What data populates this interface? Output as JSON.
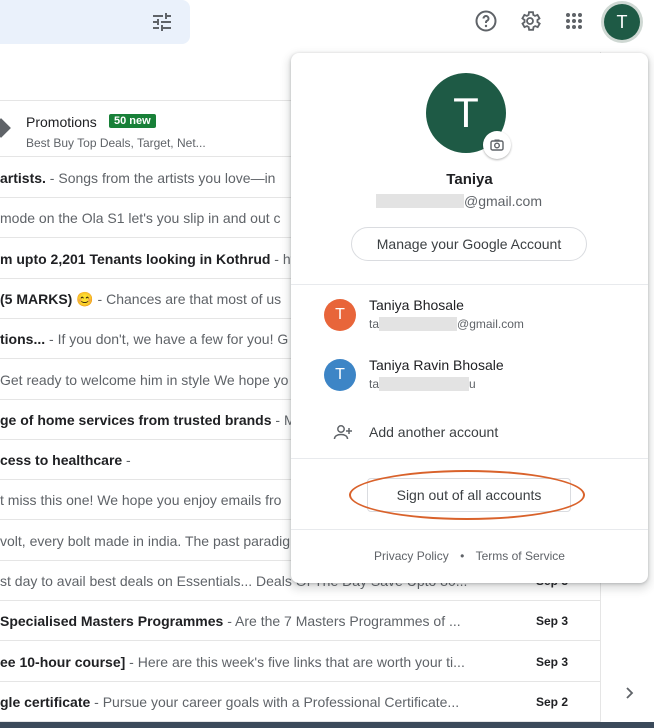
{
  "header": {
    "filter_icon": "tune-icon",
    "help_icon": "help-icon",
    "settings_icon": "gear-icon",
    "apps_icon": "apps-grid-icon",
    "avatar_letter": "T"
  },
  "promotions": {
    "title": "Promotions",
    "badge": "50 new",
    "subtitle": "Best Buy Top Deals, Target, Net..."
  },
  "emails": [
    {
      "bold": "artists.",
      "rest": " - Songs from the artists you love—in",
      "date": ""
    },
    {
      "bold": "",
      "rest": "mode on the Ola S1 let's you slip in and out c",
      "date": ""
    },
    {
      "bold": "m upto 2,201 Tenants looking in Kothrud",
      "rest": " - htt",
      "date": ""
    },
    {
      "bold": "(5 MARKS) 😊",
      "rest": " - Chances are that most of us",
      "date": ""
    },
    {
      "bold": "tions...",
      "rest": " - If you don't, we have a few for you! G",
      "date": ""
    },
    {
      "bold": "",
      "rest": "Get ready to welcome him in style We hope yo",
      "date": ""
    },
    {
      "bold": "ge of home services from trusted brands",
      "rest": " - My",
      "date": ""
    },
    {
      "bold": "cess to healthcare",
      "rest": " -",
      "date": ""
    },
    {
      "bold": "",
      "rest": "t miss this one! We hope you enjoy emails fro",
      "date": ""
    },
    {
      "bold": "",
      "rest": "volt, every bolt made in india. The past paradig",
      "date": ""
    },
    {
      "bold": "",
      "rest": "st day to avail best deals on Essentials... Deals Of The Day Save Upto 80...",
      "date": "Sep 3"
    },
    {
      "bold": " Specialised Masters Programmes",
      "rest": " - Are the 7 Masters Programmes of ...",
      "date": "Sep 3"
    },
    {
      "bold": "ee 10-hour course]",
      "rest": " - Here are this week's five links that are worth your ti...",
      "date": "Sep 3"
    },
    {
      "bold": "gle certificate",
      "rest": " - Pursue your career goals with a Professional Certificate...",
      "date": "Sep 2"
    }
  ],
  "account_popup": {
    "avatar_letter": "T",
    "camera_icon": "camera-icon",
    "name": "Taniya",
    "email_suffix": "@gmail.com",
    "manage_label": "Manage your Google Account",
    "accounts": [
      {
        "letter": "T",
        "name": "Taniya Bhosale",
        "email_prefix": "ta",
        "email_suffix": "@gmail.com",
        "color": "#e8653a"
      },
      {
        "letter": "T",
        "name": "Taniya Ravin Bhosale",
        "email_prefix": "ta",
        "email_suffix": "u",
        "color": "#3d85c6"
      }
    ],
    "add_account_label": "Add another account",
    "signout_label": "Sign out of all accounts",
    "privacy_label": "Privacy Policy",
    "dot": "•",
    "terms_label": "Terms of Service"
  }
}
